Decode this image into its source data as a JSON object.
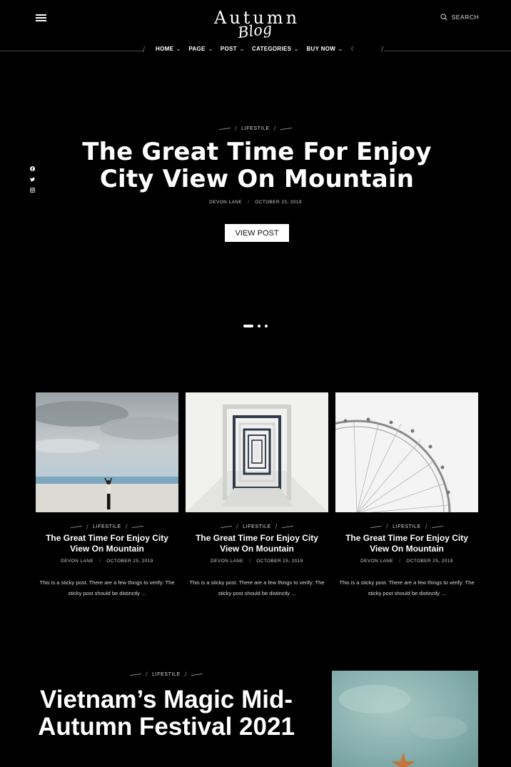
{
  "header": {
    "logo_main": "Autumn",
    "logo_script": "Blog",
    "search_label": "SEARCH"
  },
  "nav": {
    "items": [
      {
        "label": "HOME"
      },
      {
        "label": "PAGE"
      },
      {
        "label": "POST"
      },
      {
        "label": "CATEGORIES"
      },
      {
        "label": "BUY NOW"
      }
    ],
    "chevron": "⌄",
    "dark_mode_icon": "☾"
  },
  "hero": {
    "category": "LIFESTILE",
    "title_line1": "The Great Time For Enjoy",
    "title_line2": "City View On Mountain",
    "author": "DEVON LANE",
    "date": "OCTOBER 25, 2019",
    "button": "VIEW POST",
    "slide_count": 3,
    "active_slide": 1
  },
  "socials": [
    "facebook-icon",
    "twitter-icon",
    "instagram-icon"
  ],
  "cards": [
    {
      "category": "LIFESTILE",
      "title": "The Great Time For Enjoy City View On Mountain",
      "author": "DEVON LANE",
      "date": "OCTOBER 25, 2019",
      "excerpt": "This is a sticky post. There are a few things to verify: The sticky post should be distinctly ..."
    },
    {
      "category": "LIFESTILE",
      "title": "The Great Time For Enjoy City View On Mountain",
      "author": "DEVON LANE",
      "date": "OCTOBER 25, 2019",
      "excerpt": "This is a sticky post. There are a few things to verify: The sticky post should be distinctly ..."
    },
    {
      "category": "LIFESTILE",
      "title": "The Great Time For Enjoy City View On Mountain",
      "author": "DEVON LANE",
      "date": "OCTOBER 25, 2019",
      "excerpt": "This is a sticky post. There are a few things to verify: The sticky post should be distinctly ..."
    }
  ],
  "feature": {
    "category": "LIFESTILE",
    "title": "Vietnam’s Magic Mid-Autumn Festival 2021"
  },
  "separator": "/"
}
